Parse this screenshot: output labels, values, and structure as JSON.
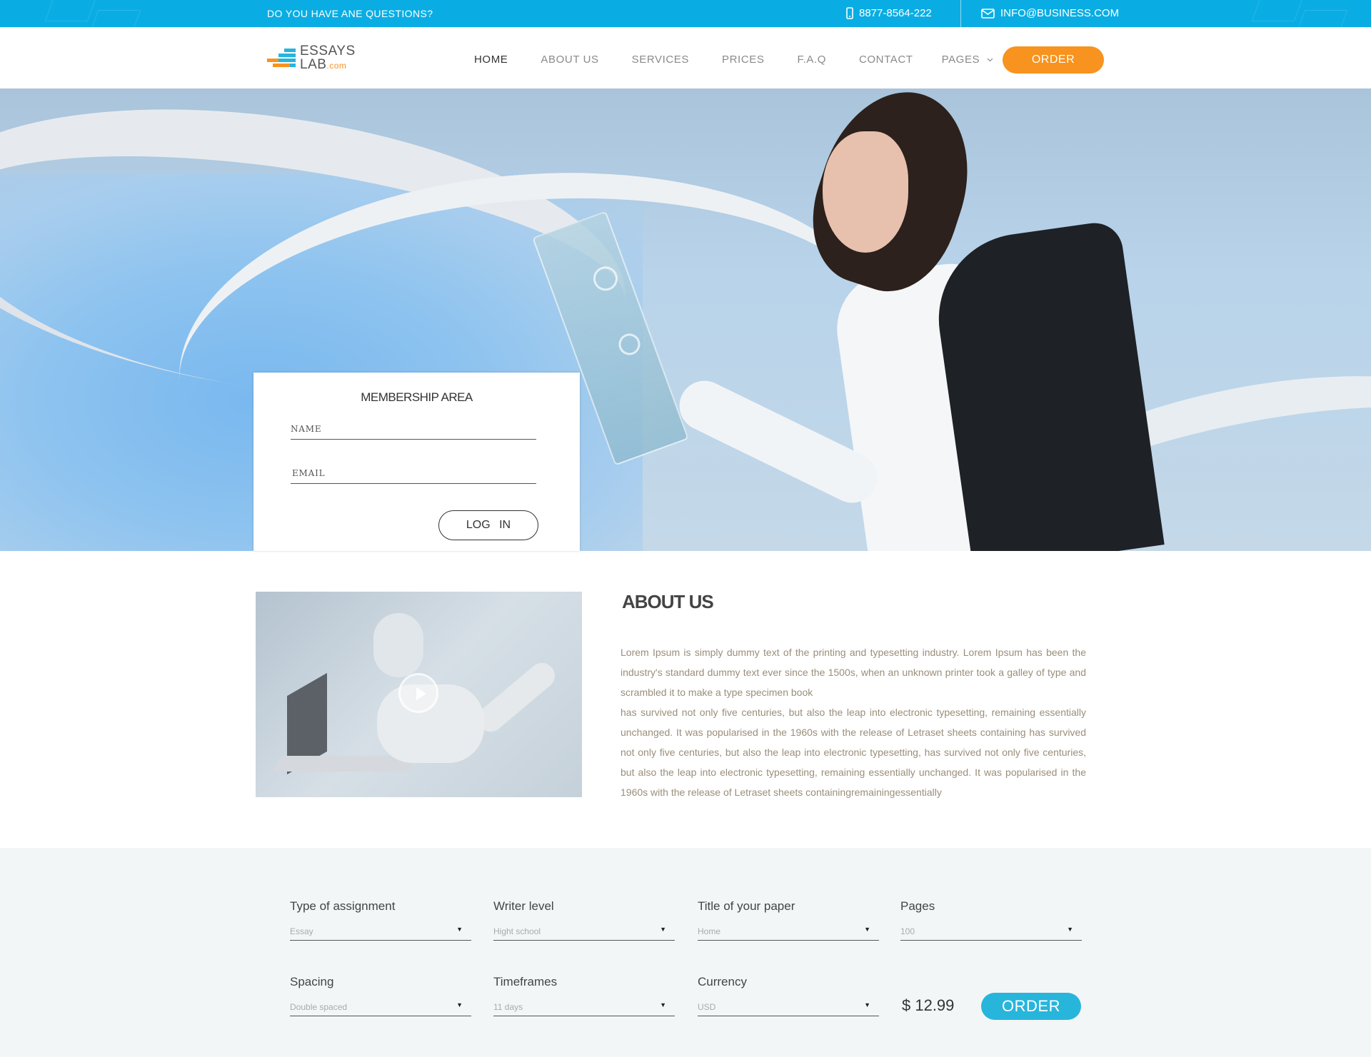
{
  "topbar": {
    "question": "DO YOU HAVE ANE QUESTIONS?",
    "phone": "8877-8564-222",
    "email": "INFO@BUSINESS.COM",
    "phone_icon": "phone-icon",
    "mail_icon": "mail-icon",
    "bg_color": "#0aade3"
  },
  "logo": {
    "line1": "ESSAYS",
    "line2": "LAB",
    "suffix": ".com"
  },
  "nav": {
    "items": [
      "HOME",
      "ABOUT US",
      "SERVICES",
      "PRICES",
      "F.A.Q",
      "CONTACT"
    ],
    "pages_label": "PAGES",
    "order_label": "ORDER",
    "active": "HOME",
    "order_color": "#f7931e"
  },
  "login": {
    "title": "MEMBERSHIP AREA",
    "name_label": "NAME",
    "email_label": "EMAIL",
    "button": "LOG  IN"
  },
  "about": {
    "title": "ABOUT US",
    "paragraph1": "Lorem Ipsum is simply dummy text of the printing and typesetting industry. Lorem Ipsum has been the industry's standard dummy text ever since the 1500s, when an unknown printer took a galley of type and scrambled it to make a type specimen book",
    "paragraph2": "has survived not only five centuries, but also the leap into electronic typesetting, remaining essentially unchanged. It was popularised in the 1960s with the release of Letraset sheets containing has survived not only five centuries, but also the leap into electronic typesetting, has survived not only five centuries, but also the leap into electronic typesetting, remaining essentially unchanged. It was popularised in the 1960s with the release of Letraset sheets containingremainingessentially"
  },
  "order_form": {
    "fields": [
      {
        "label": "Type of assignment",
        "value": "Essay"
      },
      {
        "label": "Writer level",
        "value": "Hight school"
      },
      {
        "label": "Title of your paper",
        "value": "Home"
      },
      {
        "label": "Pages",
        "value": "100"
      },
      {
        "label": "Spacing",
        "value": "Double spaced"
      },
      {
        "label": "Timeframes",
        "value": "11 days"
      },
      {
        "label": "Currency",
        "value": "USD"
      }
    ],
    "price": "$ 12.99",
    "order_label": "ORDER",
    "order_color": "#27b5dc"
  }
}
